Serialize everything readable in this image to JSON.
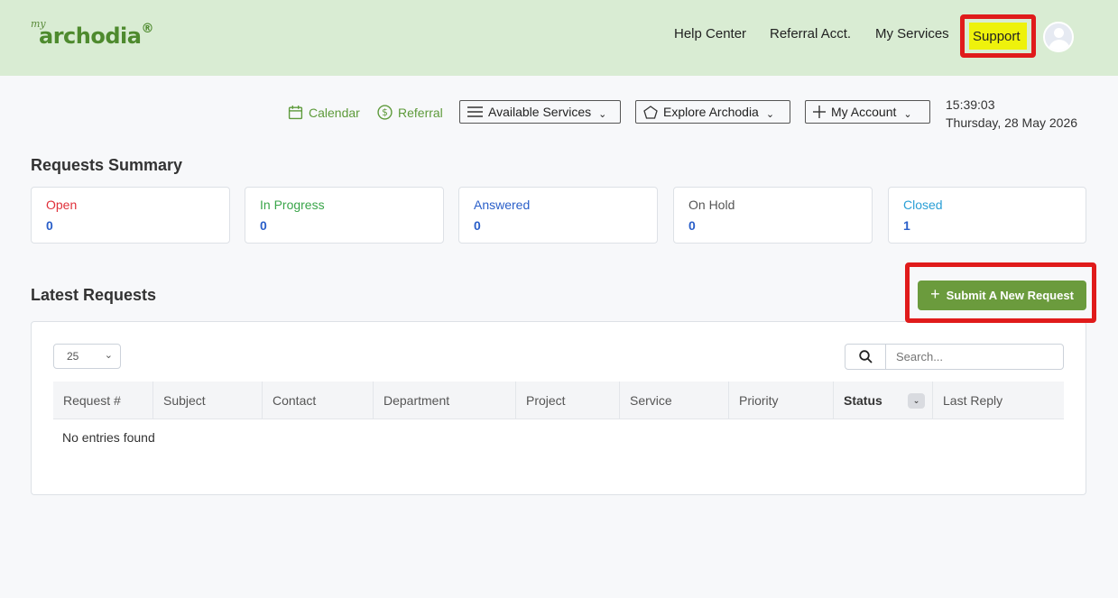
{
  "header": {
    "logo_prefix": "my",
    "logo_brand": "archodia",
    "logo_mark": "®",
    "nav": [
      "Help Center",
      "Referral Acct.",
      "My Services"
    ],
    "support_label": "Support",
    "avatar_icon": "user-avatar-icon"
  },
  "toolbar": {
    "calendar_label": "Calendar",
    "referral_label": "Referral",
    "available_services_label": "Available Services",
    "explore_label": "Explore Archodia",
    "my_account_label": "My Account",
    "time": "15:39:03",
    "date": "Thursday, 28 May 2026"
  },
  "summary": {
    "title": "Requests Summary",
    "cards": [
      {
        "label": "Open",
        "value": "0",
        "color": "#e0303a"
      },
      {
        "label": "In Progress",
        "value": "0",
        "color": "#3aa54a"
      },
      {
        "label": "Answered",
        "value": "0",
        "color": "#2a5fc9"
      },
      {
        "label": "On Hold",
        "value": "0",
        "color": "#555555"
      },
      {
        "label": "Closed",
        "value": "1",
        "color": "#2a9fd6"
      }
    ]
  },
  "latest": {
    "title": "Latest Requests",
    "submit_label": "Submit A New Request",
    "page_length": "25",
    "search_placeholder": "Search...",
    "columns": [
      "Request #",
      "Subject",
      "Contact",
      "Department",
      "Project",
      "Service",
      "Priority",
      "Status",
      "Last Reply"
    ],
    "empty_text": "No entries found"
  },
  "colors": {
    "header_bg": "#d9ecd3",
    "accent_green": "#6b9b3d",
    "highlight_red": "#e01b1b",
    "highlight_yellow": "#eef20c"
  }
}
